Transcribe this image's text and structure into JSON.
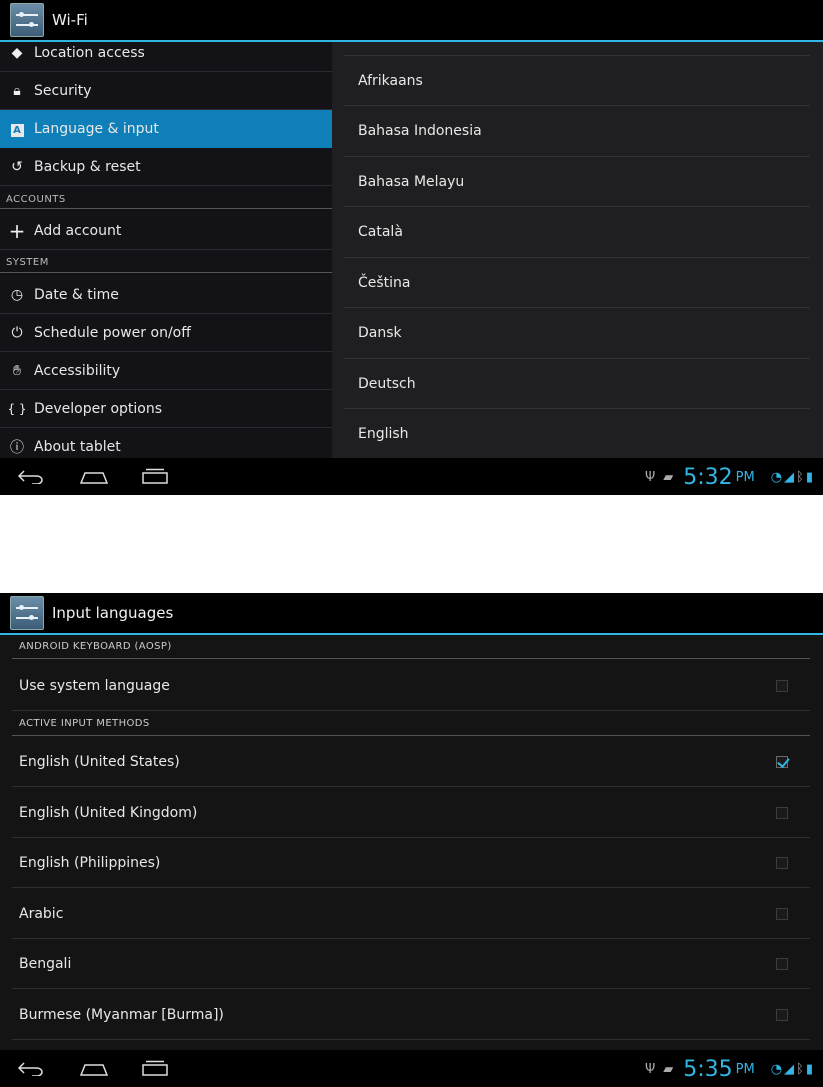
{
  "screen1": {
    "title": "Wi-Fi",
    "left_items": [
      {
        "label": "Location access",
        "icon": "location-icon"
      },
      {
        "label": "Security",
        "icon": "lock-icon"
      },
      {
        "label": "Language & input",
        "icon": "keyboard-a-icon",
        "selected": true
      },
      {
        "label": "Backup & reset",
        "icon": "backup-icon"
      },
      {
        "label": "Add account",
        "icon": "plus-icon"
      },
      {
        "label": "Date & time",
        "icon": "clock-icon"
      },
      {
        "label": "Schedule power on/off",
        "icon": "power-schedule-icon"
      },
      {
        "label": "Accessibility",
        "icon": "hand-icon"
      },
      {
        "label": "Developer options",
        "icon": "braces-icon"
      },
      {
        "label": "About tablet",
        "icon": "info-icon"
      }
    ],
    "headers": {
      "accounts": "ACCOUNTS",
      "system": "SYSTEM"
    },
    "languages": [
      "Afrikaans",
      "Bahasa Indonesia",
      "Bahasa Melayu",
      "Català",
      "Čeština",
      "Dansk",
      "Deutsch",
      "English"
    ],
    "time": "5:32",
    "ampm": "PM"
  },
  "screen2": {
    "title": "Input languages",
    "cat_keyboard": "ANDROID KEYBOARD (AOSP)",
    "use_system": "Use system language",
    "cat_active": "ACTIVE INPUT METHODS",
    "methods": [
      {
        "label": "English (United States)",
        "checked": true
      },
      {
        "label": "English (United Kingdom)",
        "checked": false
      },
      {
        "label": "English (Philippines)",
        "checked": false
      },
      {
        "label": "Arabic",
        "checked": false
      },
      {
        "label": "Bengali",
        "checked": false
      },
      {
        "label": "Burmese (Myanmar [Burma])",
        "checked": false
      }
    ],
    "time": "5:35",
    "ampm": "PM"
  },
  "colors": {
    "accent": "#33b5e5",
    "selected": "#0e7fb8"
  }
}
